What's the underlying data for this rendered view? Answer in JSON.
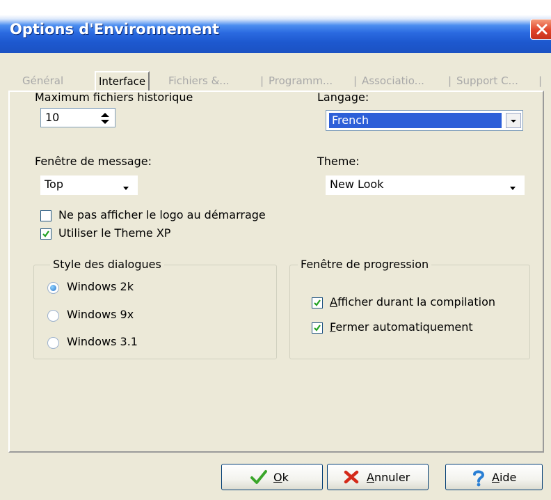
{
  "window": {
    "title": "Options d'Environnement"
  },
  "tabs": [
    {
      "label": "Général"
    },
    {
      "label": "Interface"
    },
    {
      "label": "Fichiers &..."
    },
    {
      "label": "Programm..."
    },
    {
      "label": "Associatio..."
    },
    {
      "label": "Support C..."
    }
  ],
  "history": {
    "label": "Maximum fichiers historique",
    "value": "10"
  },
  "language": {
    "label": "Langage:",
    "value": "French"
  },
  "message_window": {
    "label": "Fenêtre de message:",
    "value": "Top"
  },
  "theme": {
    "label": "Theme:",
    "value": "New Look"
  },
  "checkboxes": [
    {
      "label": "Ne pas afficher le logo au démarrage",
      "checked": false
    },
    {
      "label": "Utiliser le Theme XP",
      "checked": true
    }
  ],
  "dialog_style": {
    "title": "Style des dialogues",
    "options": [
      {
        "label": "Windows 2k",
        "selected": true
      },
      {
        "label": "Windows 9x",
        "selected": false
      },
      {
        "label": "Windows 3.1",
        "selected": false
      }
    ]
  },
  "progress_window": {
    "title": "Fenêtre de progression",
    "options": [
      {
        "mnemonic": "A",
        "rest": "fficher durant la compilation",
        "checked": true
      },
      {
        "mnemonic": "F",
        "rest": "ermer automatiquement",
        "checked": true
      }
    ]
  },
  "buttons": {
    "ok": {
      "mnemonic": "O",
      "rest": "k"
    },
    "cancel": {
      "mnemonic": "A",
      "rest": "nnuler"
    },
    "help": {
      "mnemonic": "A",
      "rest": "ide"
    }
  },
  "colors": {
    "title_bar": "#1d58cf",
    "selection": "#2d5fd8",
    "dialog_bg": "#ece9d8",
    "close_button": "#e0442a",
    "checkmark": "#21a121"
  },
  "icons": {
    "ok": "checkmark-icon",
    "cancel": "red-x-icon",
    "help": "question-mark-icon"
  }
}
